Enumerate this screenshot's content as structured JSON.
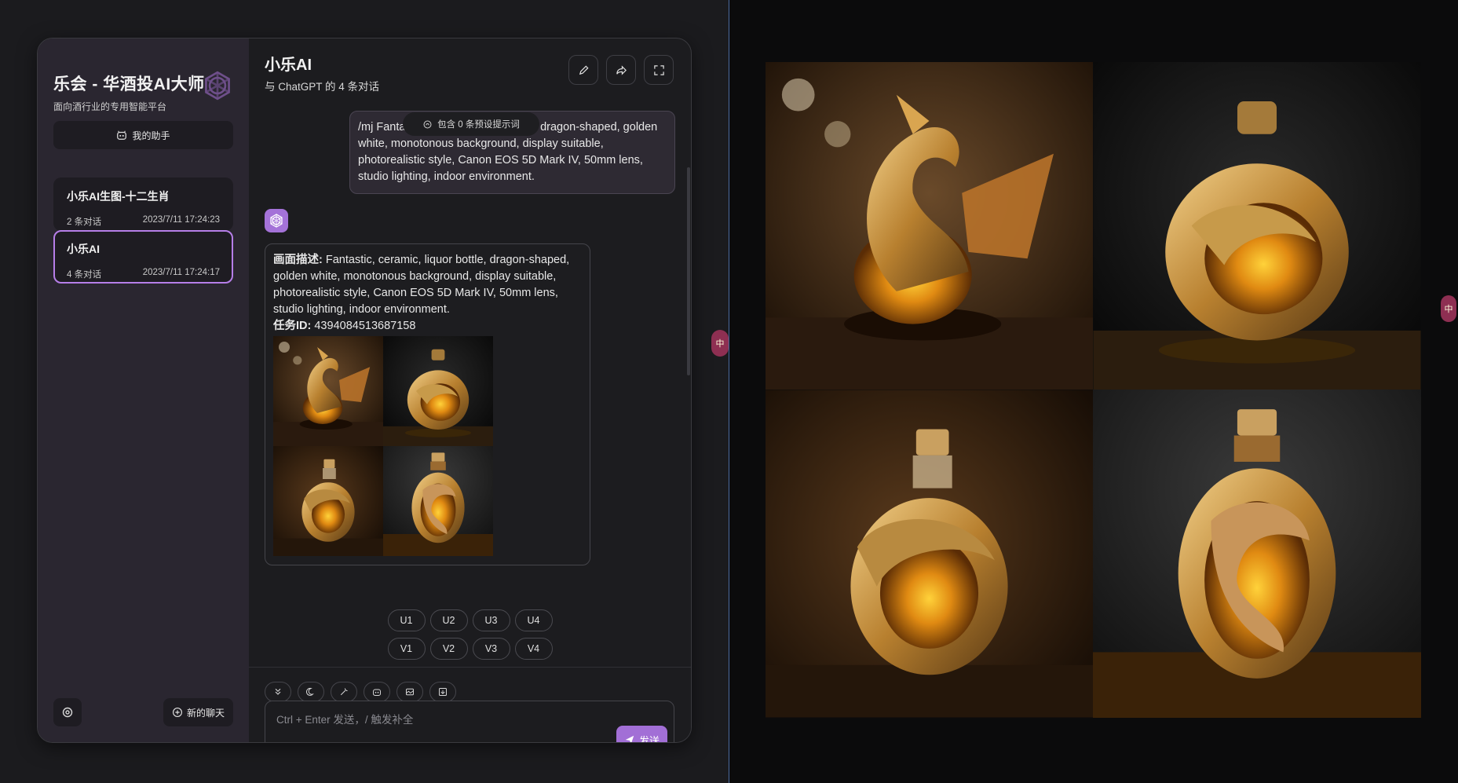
{
  "sidebar": {
    "brand_title": "乐会 - 华酒投AI大师",
    "brand_subtitle": "面向酒行业的专用智能平台",
    "assistant_label": "我的助手",
    "sessions": [
      {
        "title": "小乐AI生图-十二生肖",
        "count": "2 条对话",
        "time": "2023/7/11 17:24:23"
      },
      {
        "title": "小乐AI",
        "count": "4 条对话",
        "time": "2023/7/11 17:24:17"
      }
    ],
    "new_chat_label": "新的聊天"
  },
  "chat": {
    "title": "小乐AI",
    "subtitle": "与 ChatGPT 的 4 条对话",
    "preset_pill": "包含 0 条预设提示词",
    "user_message": "/mj Fantastic, ceramic, liquor bottle, dragon-shaped, golden white, monotonous background, display suitable, photorealistic style, Canon EOS 5D Mark IV, 50mm lens, studio lighting, indoor environment.",
    "bot_desc_label": "画面描述:",
    "bot_desc_text": " Fantastic, ceramic, liquor bottle, dragon-shaped, golden white, monotonous background, display suitable, photorealistic style, Canon EOS 5D Mark IV, 50mm lens, studio lighting, indoor environment.",
    "task_label": "任务ID:",
    "task_id": " 4394084513687158",
    "upscale_buttons": [
      "U1",
      "U2",
      "U3",
      "U4"
    ],
    "variation_buttons": [
      "V1",
      "V2",
      "V3",
      "V4"
    ]
  },
  "input": {
    "placeholder": "Ctrl + Enter 发送，/ 触发补全",
    "send_label": "发送"
  },
  "badge": "中",
  "colors": {
    "accent": "#a26fd6",
    "active_border": "#b67ee8",
    "sidebar_bg": "#2a2630",
    "page_bg": "#1b1b1e",
    "viewer_bg": "#0b0b0c"
  },
  "icons": {
    "brand": "openai-logo-icon",
    "assistant": "robot-face-icon",
    "edit": "pencil-icon",
    "share": "share-arrow-icon",
    "fullscreen": "expand-icon",
    "settings": "gear-icon",
    "new_chat": "plus-circle-icon",
    "send": "paper-plane-icon"
  }
}
